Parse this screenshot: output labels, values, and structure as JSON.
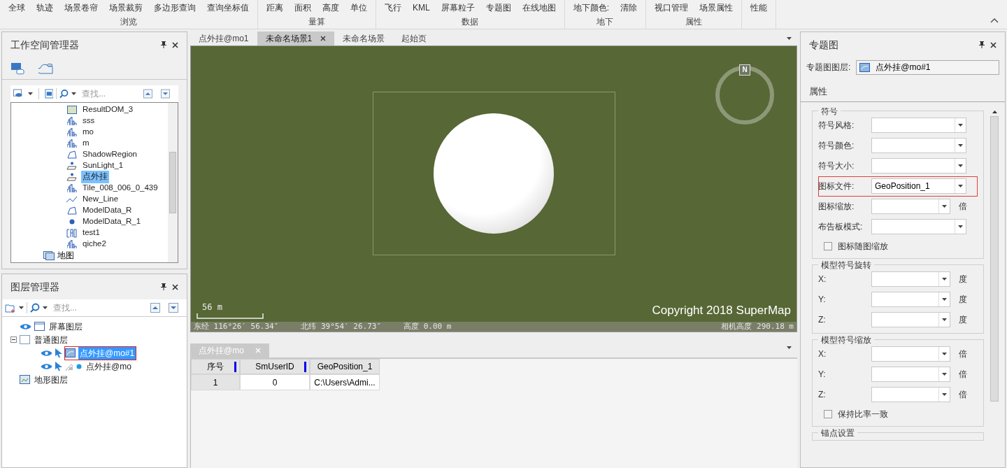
{
  "ribbon": {
    "groups": [
      {
        "label": "浏览",
        "items": [
          "全球",
          "轨迹",
          "场景卷帘",
          "场景裁剪",
          "多边形查询",
          "查询坐标值"
        ]
      },
      {
        "label": "量算",
        "items": [
          "距离",
          "面积",
          "高度",
          "单位"
        ]
      },
      {
        "label": "数据",
        "items": [
          "飞行",
          "KML",
          "屏幕粒子",
          "专题图",
          "在线地图"
        ]
      },
      {
        "label": "地下",
        "items": [
          "地下颜色:",
          "清除"
        ]
      },
      {
        "label": "属性",
        "items": [
          "视口管理",
          "场景属性"
        ]
      },
      {
        "items": [
          "性能"
        ]
      }
    ]
  },
  "workspace": {
    "title": "工作空间管理器",
    "search_placeholder": "查找...",
    "tree": [
      {
        "children": [
          {
            "label": "ResultDOM_3",
            "kind": "image",
            "selected": false
          },
          {
            "label": "sss",
            "kind": "model",
            "selected": false
          },
          {
            "label": "mo",
            "kind": "model",
            "selected": false
          },
          {
            "label": "m",
            "kind": "model",
            "selected": false
          },
          {
            "label": "ShadowRegion",
            "kind": "region",
            "selected": false
          },
          {
            "label": "SunLight_1",
            "kind": "point3d",
            "selected": false
          },
          {
            "label": "点外挂",
            "kind": "point3d",
            "selected": true
          },
          {
            "label": "Tile_008_006_0_439",
            "kind": "model",
            "selected": false
          },
          {
            "label": "New_Line",
            "kind": "line",
            "selected": false
          },
          {
            "label": "ModelData_R",
            "kind": "region",
            "selected": false
          },
          {
            "label": "ModelData_R_1",
            "kind": "point",
            "selected": false
          },
          {
            "label": "test1",
            "kind": "cad",
            "selected": false
          },
          {
            "label": "qiche2",
            "kind": "model",
            "selected": false
          }
        ]
      },
      {
        "label": "地图",
        "kind": "map",
        "selected": false
      }
    ]
  },
  "layers": {
    "title": "图层管理器",
    "search_placeholder": "查找...",
    "tree": [
      {
        "label": "屏幕图层",
        "kind": "screen",
        "selected": false
      },
      {
        "label": "普通图层",
        "kind": "normal",
        "selected": false,
        "expanded": true,
        "children": [
          {
            "label": "点外挂@mo#1",
            "kind": "theme",
            "selected": true,
            "outlined": true
          },
          {
            "label": "点外挂@mo",
            "kind": "point",
            "selected": false,
            "outlined": false
          }
        ]
      },
      {
        "label": "地形图层",
        "kind": "terrain",
        "selected": false
      }
    ]
  },
  "doc_tabs": [
    {
      "label": "点外挂@mo1",
      "selected": false
    },
    {
      "label": "未命名场景1",
      "selected": true
    },
    {
      "label": "未命名场景",
      "selected": false
    },
    {
      "label": "起始页",
      "selected": false
    }
  ],
  "scene": {
    "compass": "N",
    "scale": "56 m",
    "copyright": "Copyright 2018 SuperMap",
    "status": [
      "东经 116°26′ 56.34″",
      "北纬 39°54′ 26.73″",
      "高度 0.00 m"
    ],
    "camera": "相机高度 290.18 m"
  },
  "table_tab": {
    "label": "点外挂@mo"
  },
  "table": {
    "columns": [
      "序号",
      "SmUserID",
      "GeoPosition_1"
    ],
    "rows": [
      [
        "1",
        "0",
        "C:\\Users\\Admi..."
      ]
    ]
  },
  "theme_panel": {
    "title": "专题图",
    "layer_label": "专题图图层:",
    "layer_value": "点外挂@mo#1",
    "tab": "属性",
    "groups": [
      {
        "title": "符号",
        "rows": [
          {
            "kind": "select",
            "label": "符号风格:",
            "outlined": false
          },
          {
            "kind": "select",
            "label": "符号颜色:",
            "outlined": false
          },
          {
            "kind": "select",
            "label": "符号大小:",
            "outlined": false
          },
          {
            "kind": "select",
            "label": "图标文件:",
            "value": "GeoPosition_1",
            "outlined": true
          },
          {
            "kind": "spin",
            "label": "图标缩放:",
            "unit": "倍"
          },
          {
            "kind": "select",
            "label": "布告板模式:",
            "outlined": false
          },
          {
            "kind": "checkbox",
            "label": "图标随图缩放",
            "checked": false
          }
        ]
      },
      {
        "title": "模型符号旋转",
        "rows": [
          {
            "kind": "spin",
            "label": "X:",
            "unit": "度"
          },
          {
            "kind": "spin",
            "label": "Y:",
            "unit": "度"
          },
          {
            "kind": "spin",
            "label": "Z:",
            "unit": "度"
          }
        ]
      },
      {
        "title": "模型符号缩放",
        "rows": [
          {
            "kind": "spin",
            "label": "X:",
            "unit": "倍"
          },
          {
            "kind": "spin",
            "label": "Y:",
            "unit": "倍"
          },
          {
            "kind": "spin",
            "label": "Z:",
            "unit": "倍"
          },
          {
            "kind": "checkbox",
            "label": "保持比率一致",
            "checked": false
          }
        ]
      },
      {
        "title": "锚点设置"
      }
    ]
  }
}
